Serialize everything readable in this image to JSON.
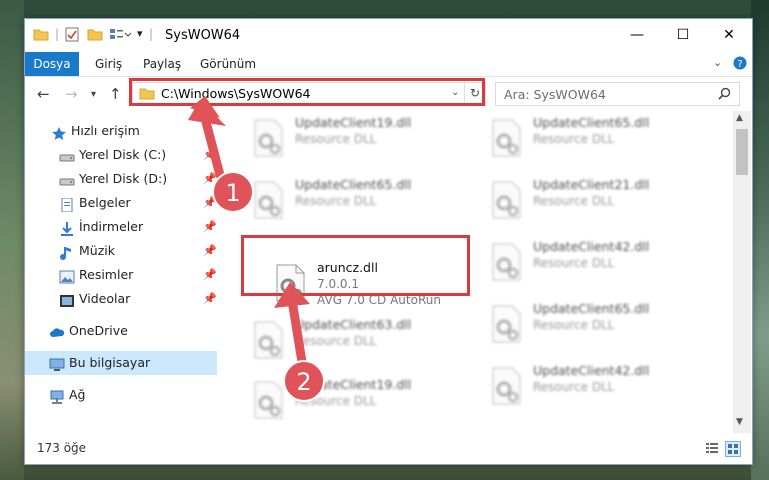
{
  "window": {
    "title": "SysWOW64",
    "controls": {
      "minimize": "—",
      "maximize": "☐",
      "close": "✕"
    }
  },
  "ribbon": {
    "tabs": [
      {
        "label": "Dosya",
        "active": true
      },
      {
        "label": "Giriş"
      },
      {
        "label": "Paylaş"
      },
      {
        "label": "Görünüm"
      }
    ]
  },
  "nav": {
    "address": "C:\\Windows\\SysWOW64",
    "search_placeholder": "Ara: SysWOW64"
  },
  "sidebar": {
    "items": [
      {
        "label": "Hızlı erişim",
        "icon": "star-icon"
      },
      {
        "label": "Yerel Disk (C:)",
        "icon": "drive-icon",
        "pinned": true
      },
      {
        "label": "Yerel Disk (D:)",
        "icon": "drive-icon",
        "pinned": true
      },
      {
        "label": "Belgeler",
        "icon": "document-icon",
        "pinned": true
      },
      {
        "label": "İndirmeler",
        "icon": "download-icon",
        "pinned": true
      },
      {
        "label": "Müzik",
        "icon": "music-icon",
        "pinned": true
      },
      {
        "label": "Resimler",
        "icon": "picture-icon",
        "pinned": true
      },
      {
        "label": "Videolar",
        "icon": "video-icon",
        "pinned": true
      },
      {
        "label": "OneDrive",
        "icon": "cloud-icon"
      },
      {
        "label": "Bu bilgisayar",
        "icon": "computer-icon",
        "selected": true
      },
      {
        "label": "Ağ",
        "icon": "network-icon"
      }
    ]
  },
  "files": {
    "left": [
      {
        "name": "UpdateClient19.dll",
        "desc": "Resource DLL"
      },
      {
        "name": "UpdateClient65.dll",
        "desc": "Resource DLL"
      },
      {
        "name": "aruncz.dll",
        "version": "7.0.0.1",
        "desc": "AVG 7.0 CD AutoRun",
        "highlighted": true
      },
      {
        "name": "UpdateClient63.dll",
        "desc": "Resource DLL"
      },
      {
        "name": "UpdateClient19.dll",
        "desc": "Resource DLL"
      }
    ],
    "right": [
      {
        "name": "UpdateClient65.dll",
        "desc": "Resource DLL"
      },
      {
        "name": "UpdateClient21.dll",
        "desc": "Resource DLL"
      },
      {
        "name": "UpdateClient42.dll",
        "desc": "Resource DLL"
      },
      {
        "name": "UpdateClient65.dll",
        "desc": "Resource DLL"
      },
      {
        "name": "UpdateClient42.dll",
        "desc": "Resource DLL"
      }
    ]
  },
  "status": {
    "count": "173 öğe"
  },
  "annotations": {
    "step1": "1",
    "step2": "2"
  },
  "colors": {
    "accent": "#1979ca",
    "highlight": "#d93a3e",
    "selected": "#cce8ff"
  }
}
